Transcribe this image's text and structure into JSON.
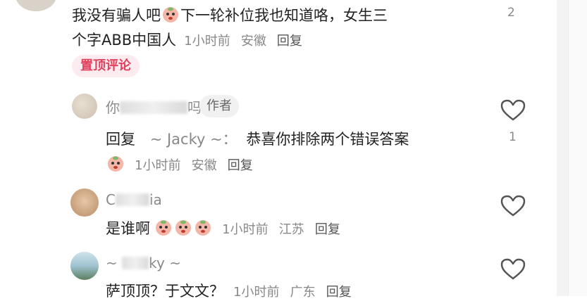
{
  "colors": {
    "pin_badge_bg": "#fdecef",
    "pin_badge_text": "#e0415c",
    "meta_gray": "#888888",
    "heart": "#555555"
  },
  "comments": [
    {
      "text_line1": "我没有骗人吧",
      "text_line1b": "下一轮补位我也知道咯，女生三",
      "text_line2": "个字ABB中国人",
      "time": "1小时前",
      "location": "安徽",
      "reply_label": "回复",
      "badge": "置顶评论",
      "like_count": "2"
    },
    {
      "name_visible": "你",
      "name_visible_end": "吗",
      "author_badge": "作者",
      "reply_prefix": "回复",
      "reply_to": "~ Jacky ~：",
      "text": "恭喜你排除两个错误答案",
      "time": "1小时前",
      "location": "安徽",
      "reply_label": "回复",
      "like_count": "1",
      "icon": "heart-outline-icon"
    },
    {
      "name_visible_start": "C",
      "name_visible_end": "ia",
      "text": "是谁啊",
      "time": "1小时前",
      "location": "江苏",
      "reply_label": "回复",
      "icon": "heart-outline-icon"
    },
    {
      "name_visible_start": "~ ",
      "name_visible_end": "ky ~",
      "text": "萨顶顶？于文文？",
      "time": "1小时前",
      "location": "广东",
      "reply_label": "回复",
      "icon": "heart-outline-icon"
    }
  ]
}
